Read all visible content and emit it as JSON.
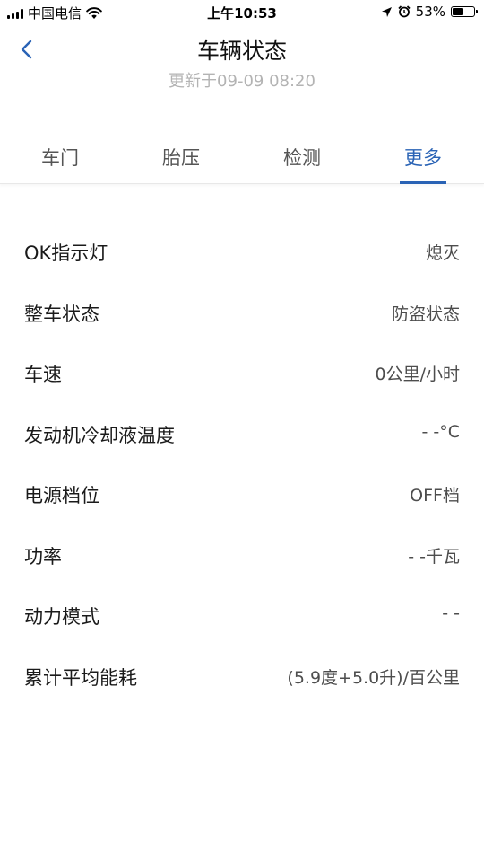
{
  "status_bar": {
    "carrier": "中国电信",
    "time": "上午10:53",
    "battery_percent": "53%",
    "battery_level": 0.53,
    "icons": [
      "signal-icon",
      "wifi-icon",
      "location-icon",
      "alarm-icon",
      "battery-icon"
    ]
  },
  "nav": {
    "back_icon": "chevron-left-icon",
    "title": "车辆状态",
    "subtitle": "更新于09-09 08:20"
  },
  "tabs": [
    {
      "label": "车门",
      "active": false
    },
    {
      "label": "胎压",
      "active": false
    },
    {
      "label": "检测",
      "active": false
    },
    {
      "label": "更多",
      "active": true
    }
  ],
  "items": [
    {
      "label": "OK指示灯",
      "value": "熄灭"
    },
    {
      "label": "整车状态",
      "value": "防盗状态"
    },
    {
      "label": "车速",
      "value": "0公里/小时"
    },
    {
      "label": "发动机冷却液温度",
      "value": "- -°C"
    },
    {
      "label": "电源档位",
      "value": "OFF档"
    },
    {
      "label": "功率",
      "value": "- -千瓦"
    },
    {
      "label": "动力模式",
      "value": "- -"
    },
    {
      "label": "累计平均能耗",
      "value": "(5.9度+5.0升)/百公里"
    }
  ],
  "colors": {
    "accent": "#2a63b5",
    "subtitle": "#b3b3b3",
    "text": "#1a1a1a",
    "value_text": "#4d4d4d"
  }
}
